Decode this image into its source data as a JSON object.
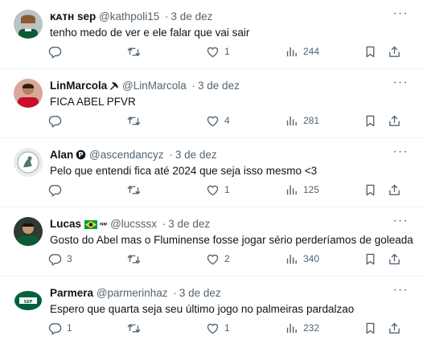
{
  "tweets": [
    {
      "name": "ᴋᴀᴛʜ sep",
      "handle": "@kathpoli15",
      "dot": "·",
      "date": "3 de dez",
      "text": "tenho medo de ver e ele falar que vai sair",
      "replies": "",
      "retweets": "",
      "likes": "1",
      "views": "244"
    },
    {
      "name": "LinMarcola",
      "handle": "@LinMarcola",
      "dot": "·",
      "date": "3 de dez",
      "text": "FICA ABEL PFVR",
      "replies": "",
      "retweets": "",
      "likes": "4",
      "views": "281"
    },
    {
      "name": "Alan",
      "handle": "@ascendancyz",
      "dot": "·",
      "date": "3 de dez",
      "text": "Pelo que entendi fica até 2024 que seja isso mesmo <3",
      "replies": "",
      "retweets": "",
      "likes": "1",
      "views": "125"
    },
    {
      "name": "Lucas",
      "name_suffix": "ᵉᵖᵖ",
      "handle": "@lucsssx",
      "dot": "·",
      "date": "3 de dez",
      "text": "Gosto do Abel mas o Fluminense fosse jogar sério perderíamos de goleada",
      "replies": "3",
      "retweets": "",
      "likes": "2",
      "views": "340"
    },
    {
      "name": "Parmera",
      "handle": "@parmerinhaz",
      "dot": "·",
      "date": "3 de dez",
      "text": "Espero que quarta seja seu último jogo no palmeiras pardalzao",
      "replies": "1",
      "retweets": "",
      "likes": "1",
      "views": "232"
    }
  ],
  "more_glyph": "···",
  "icons": [
    "reply-icon",
    "retweet-icon",
    "like-icon",
    "views-icon",
    "bookmark-icon",
    "share-icon"
  ],
  "colors": {
    "text": "#0f1419",
    "secondary": "#536471",
    "divider": "#eff3f4",
    "palmeiras_green": "#00613c"
  }
}
